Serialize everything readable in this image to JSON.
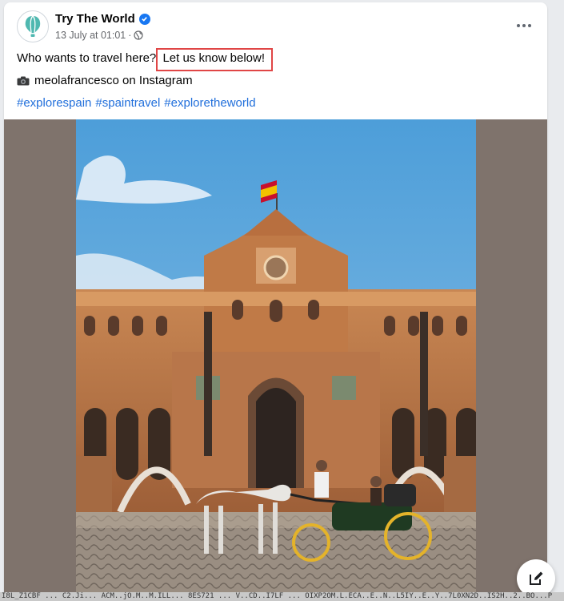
{
  "post": {
    "page_name": "Try The World",
    "timestamp": "13 July at 01:01",
    "audience_icon": "globe-icon",
    "text_part1": "Who wants to travel here?",
    "text_part2": "Let us know below!",
    "credit": "meolafrancesco on Instagram",
    "hashtags": [
      "#explorespain",
      "#spaintravel",
      "#exploretheworld"
    ]
  },
  "colors": {
    "link": "#216fdb",
    "verified": "#1877f2",
    "highlight_box": "#e04646",
    "media_background": "#7f736c"
  },
  "footer_strip": "I8L_Z1CBF ... C2.Ji... ACM..jO.M..M.ILL... 8ES721 ... V..CD..I7LF ... OIXP2OM.L.ECA..E..N..L5IY..E..Y..7L0XN2D..IS2H..2..BO...P"
}
